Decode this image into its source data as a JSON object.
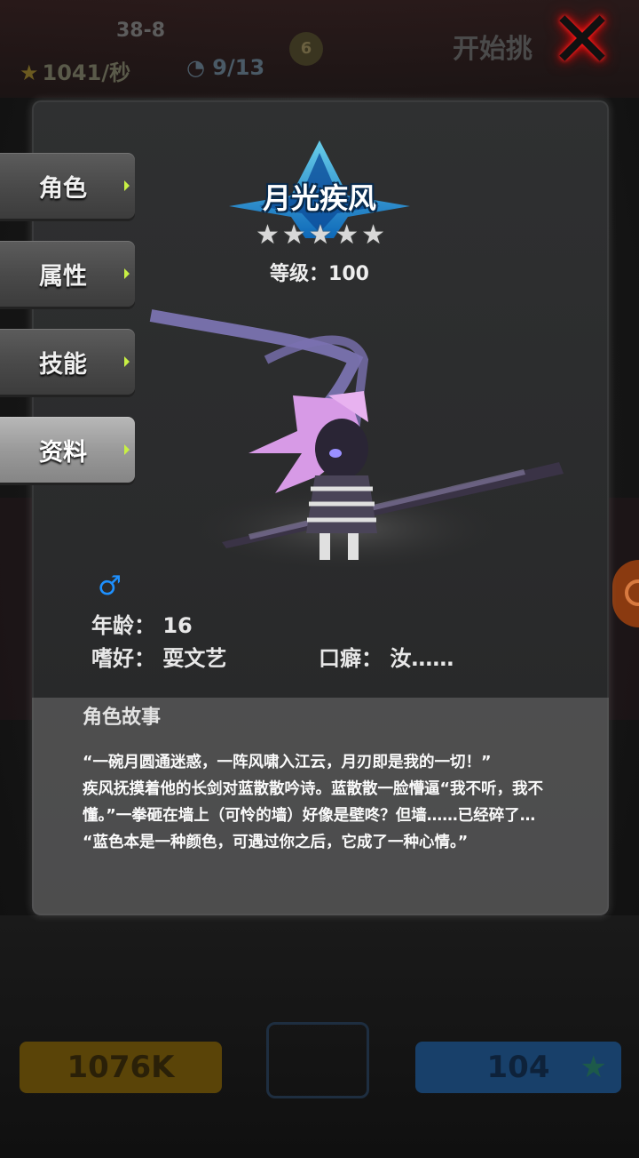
{
  "background": {
    "stage": "38-8",
    "rate": "1041/秒",
    "capacity": "9/13",
    "badge": "6",
    "start_button": "开始挑",
    "gold": "1076K",
    "gems": "104"
  },
  "tabs": [
    {
      "label": "角色",
      "active": false
    },
    {
      "label": "属性",
      "active": false
    },
    {
      "label": "技能",
      "active": false
    },
    {
      "label": "资料",
      "active": true
    }
  ],
  "hero": {
    "name": "月光疾风",
    "stars": 5,
    "level_text": "等级：100"
  },
  "profile": {
    "gender_icon": "♂",
    "age_label": "年龄：",
    "age_value": "16",
    "hobby_label": "嗜好：",
    "hobby_value": "耍文艺",
    "catchphrase_label": "口癖：",
    "catchphrase_value": "汝……"
  },
  "story": {
    "title": "角色故事",
    "text": "“一碗月圆通迷惑，一阵风啸入江云，月刃即是我的一切！”\n疾风抚摸着他的长剑对蓝散散吟诗。蓝散散一脸懵逼“我不听，我不懂。”一拳砸在墙上（可怜的墙）好像是壁咚？但墙……已经碎了…\n“蓝色本是一种颜色，可遇过你之后，它成了一种心情。”"
  },
  "colors": {
    "accent_blue": "#1e90ff",
    "tab_arrow": "#c8f044",
    "close_glow": "#ff1010"
  }
}
